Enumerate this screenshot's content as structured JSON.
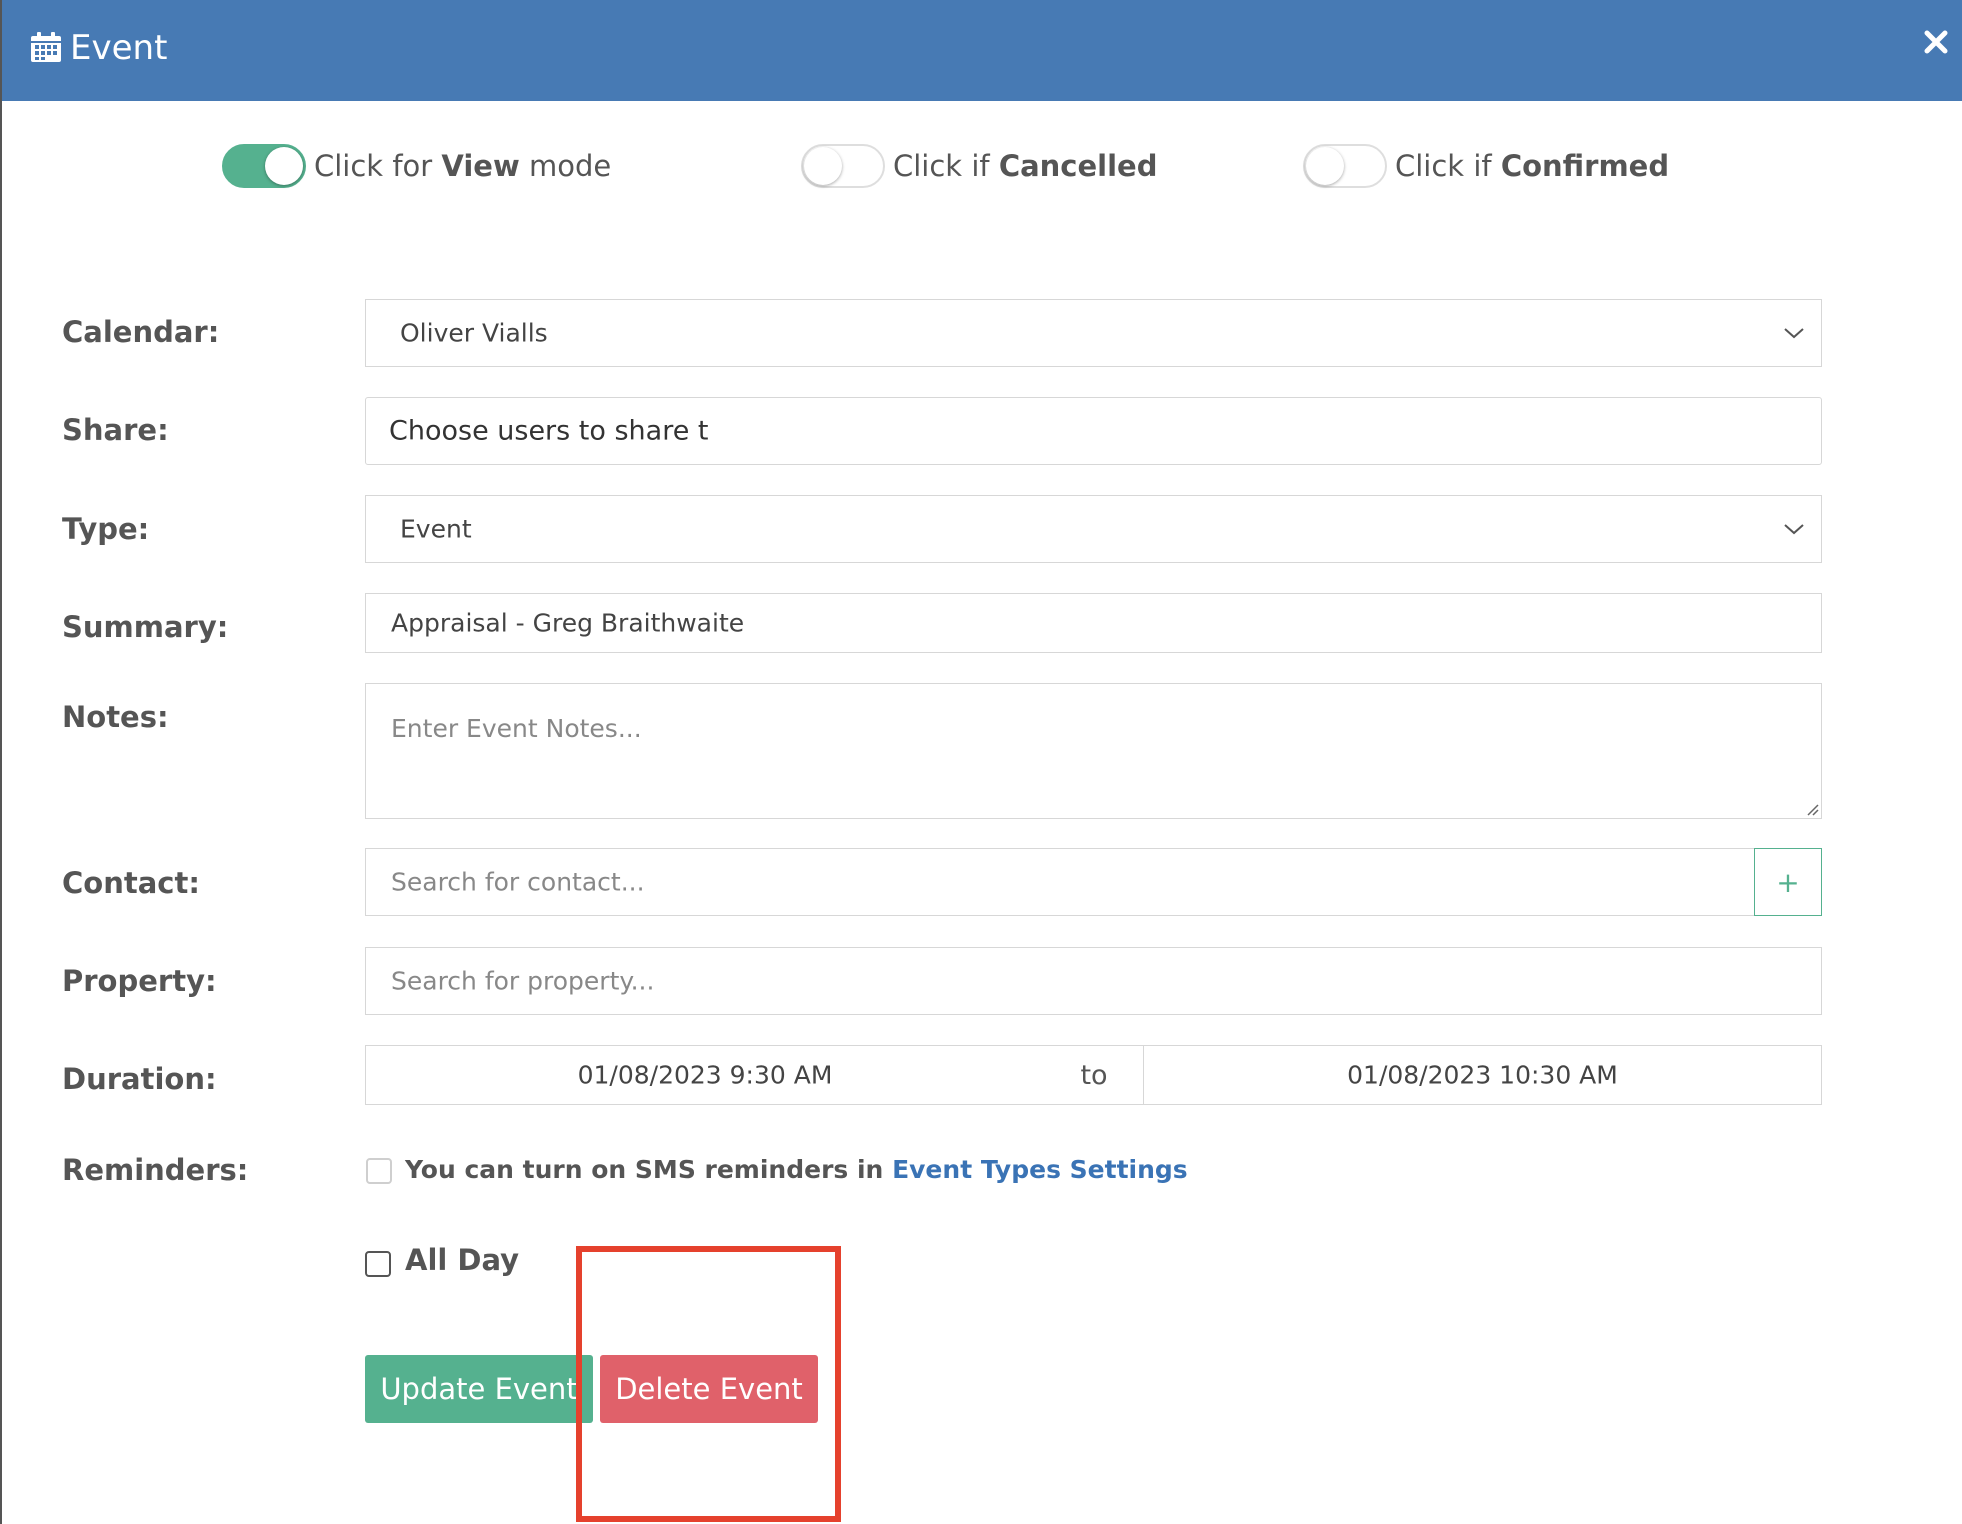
{
  "header": {
    "title": "Event",
    "icon": "calendar-icon",
    "close_icon": "close-icon",
    "background_color": "#477ab4"
  },
  "toggles": [
    {
      "prefix": "Click for ",
      "bold": "View",
      "suffix": " mode",
      "on": true
    },
    {
      "prefix": "Click if ",
      "bold": "Cancelled",
      "suffix": "",
      "on": false
    },
    {
      "prefix": "Click if ",
      "bold": "Confirmed",
      "suffix": "",
      "on": false
    }
  ],
  "form": {
    "calendar": {
      "label": "Calendar:",
      "value": "Oliver Vialls"
    },
    "share": {
      "label": "Share:",
      "value": "Choose users to share t"
    },
    "type": {
      "label": "Type:",
      "value": "Event"
    },
    "summary": {
      "label": "Summary:",
      "value": "Appraisal - Greg Braithwaite"
    },
    "notes": {
      "label": "Notes:",
      "placeholder": "Enter Event Notes..."
    },
    "contact": {
      "label": "Contact:",
      "placeholder": "Search for contact...",
      "add_label": "+"
    },
    "property": {
      "label": "Property:",
      "placeholder": "Search for property..."
    },
    "duration": {
      "label": "Duration:",
      "start": "01/08/2023 9:30 AM",
      "separator": "to",
      "end": "01/08/2023 10:30 AM"
    },
    "reminders": {
      "label": "Reminders:",
      "text": "You can turn on SMS reminders in ",
      "link": "Event Types Settings"
    },
    "all_day": {
      "label": "All Day",
      "checked": false
    }
  },
  "buttons": {
    "update": "Update Event",
    "delete": "Delete Event"
  },
  "colors": {
    "accent_green": "#55b18f",
    "danger_red": "#e0616a",
    "highlight": "#e5412d",
    "link_blue": "#3a73b5"
  }
}
